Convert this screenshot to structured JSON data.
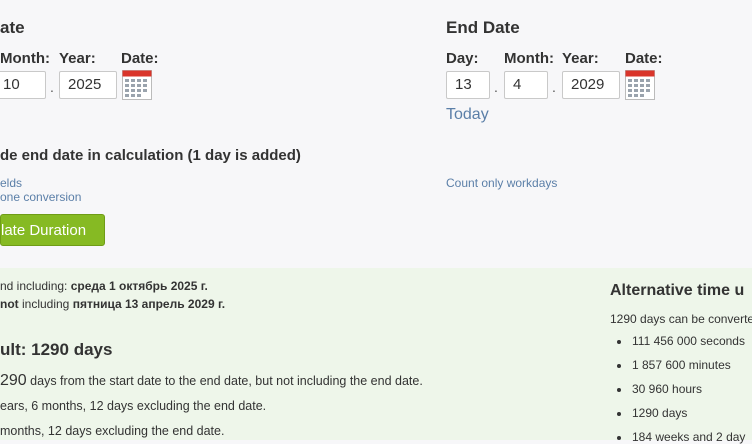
{
  "start_section": {
    "title": "ate",
    "labels": {
      "month": "Month:",
      "year": "Year:",
      "date": "Date:"
    },
    "month": "10",
    "year": "2025"
  },
  "end_section": {
    "title": "End Date",
    "labels": {
      "day": "Day:",
      "month": "Month:",
      "year": "Year:",
      "date": "Date:"
    },
    "day": "13",
    "month": "4",
    "year": "2029",
    "today_link": "Today"
  },
  "separator": ".",
  "options": {
    "include_end": "de end date in calculation (1 day is added)",
    "link_fields": "elds",
    "link_timezone": "one conversion",
    "link_workdays": "Count only workdays"
  },
  "calculate_button": "late Duration",
  "results": {
    "from_prefix": "nd including: ",
    "from_date": "среда 1 октябрь 2025 г.",
    "to_bold": "not",
    "to_mid": " including ",
    "to_date": "пятница 13 апрель 2029 г.",
    "result_title": "ult: 1290 days",
    "line1_num": "290",
    "line1_rest": " days from the start date to the end date, but not including the end date.",
    "line2": "ears, 6 months, 12 days excluding the end date.",
    "line3": "months, 12 days excluding the end date."
  },
  "alternative": {
    "title": "Alternative time u",
    "intro": "1290 days can be converte",
    "items": [
      "111 456 000 seconds",
      "1 857 600 minutes",
      "30 960 hours",
      "1290 days",
      "184 weeks and 2 day"
    ]
  },
  "colors": {
    "button": "#86ba23",
    "link": "#5b7fa8",
    "result_bg": "#eef6ea",
    "calendar_red": "#d9352b"
  },
  "icons": [
    "calendar-icon"
  ]
}
